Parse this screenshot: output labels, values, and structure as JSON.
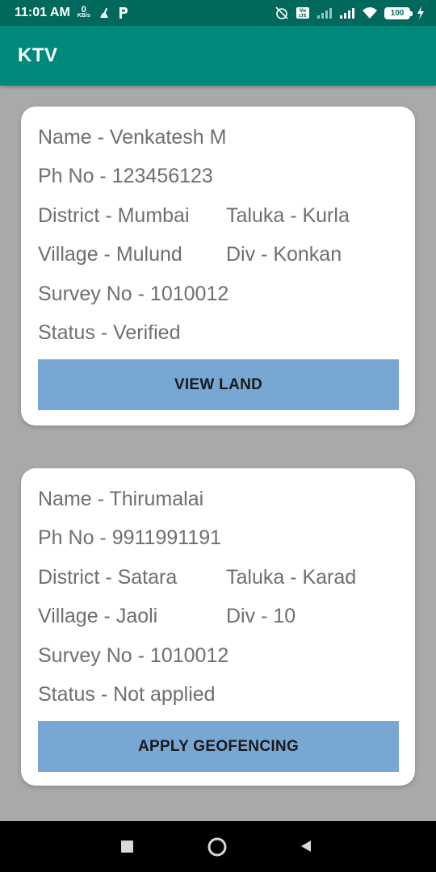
{
  "status_bar": {
    "time": "11:01 AM",
    "speed_value": "0",
    "speed_unit": "KB/s",
    "battery": "100",
    "icons": [
      "cleaner-icon",
      "parking-p-icon",
      "alarm-off-icon",
      "volte-icon",
      "signal-icon",
      "signal-icon",
      "wifi-icon",
      "battery-icon",
      "charging-icon"
    ]
  },
  "app_bar": {
    "title": "KTV"
  },
  "records": [
    {
      "name": "Name - Venkatesh M",
      "phone": "Ph No - 123456123",
      "district": "District - Mumbai",
      "taluka": "Taluka - Kurla",
      "village": "Village - Mulund",
      "div": "Div - Konkan",
      "survey": "Survey No - 1010012",
      "status": "Status - Verified",
      "button": "VIEW LAND"
    },
    {
      "name": "Name - Thirumalai",
      "phone": "Ph No - 9911991191",
      "district": "District - Satara",
      "taluka": "Taluka - Karad",
      "village": "Village - Jaoli",
      "div": "Div - 10",
      "survey": "Survey No - 1010012",
      "status": "Status - Not applied",
      "button": "APPLY GEOFENCING"
    }
  ],
  "nav_bar": {
    "icons": [
      "recent-apps-icon",
      "home-icon",
      "back-icon"
    ]
  },
  "colors": {
    "status_bar": "#00695c",
    "app_bar": "#00897b",
    "background": "#a9a9a9",
    "button": "#78a7d3",
    "text": "#6f6f6f"
  }
}
